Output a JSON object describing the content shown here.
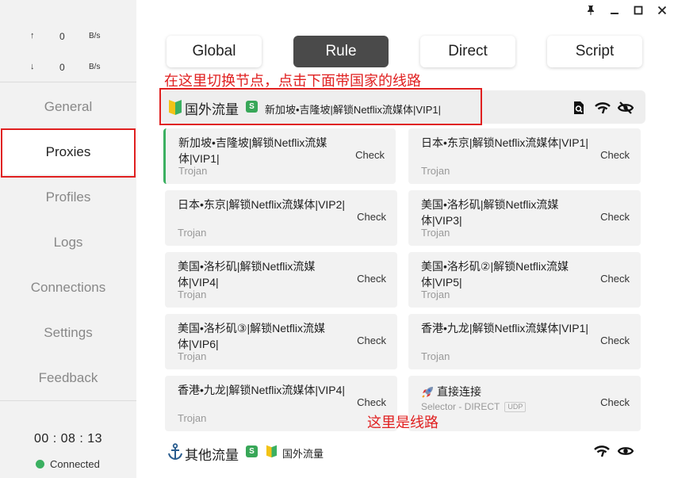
{
  "window": {
    "pin_icon": "pin-icon",
    "minimize_icon": "minimize-icon",
    "maximize_icon": "maximize-icon",
    "close_icon": "close-icon"
  },
  "sidebar": {
    "speed": {
      "upload_arrow": "↑",
      "upload_value": "0",
      "upload_unit": "B/s",
      "download_arrow": "↓",
      "download_value": "0",
      "download_unit": "B/s"
    },
    "nav": [
      {
        "label": "General",
        "active": false
      },
      {
        "label": "Proxies",
        "active": true
      },
      {
        "label": "Profiles",
        "active": false
      },
      {
        "label": "Logs",
        "active": false
      },
      {
        "label": "Connections",
        "active": false
      },
      {
        "label": "Settings",
        "active": false
      },
      {
        "label": "Feedback",
        "active": false
      }
    ],
    "timer": "00 : 08 : 13",
    "status": "Connected",
    "status_color": "#3bb061"
  },
  "modes": [
    {
      "label": "Global",
      "active": false
    },
    {
      "label": "Rule",
      "active": true
    },
    {
      "label": "Direct",
      "active": false
    },
    {
      "label": "Script",
      "active": false
    }
  ],
  "annotations": {
    "top": "在这里切换节点，点击下面带国家的线路",
    "bottom": "这里是线路",
    "color": "#e02020"
  },
  "group": {
    "icon": "beginner-shield-icon",
    "name": "国外流量",
    "badge": "S",
    "selected": "新加坡•吉隆坡|解锁Netflix流媒体|VIP1|",
    "tools": [
      "search-icon",
      "wifi-speed-icon",
      "eye-off-icon"
    ]
  },
  "proxies": [
    {
      "name": "新加坡•吉隆坡|解锁Netflix流媒体|VIP1|",
      "type": "Trojan",
      "action": "Check",
      "selected": true
    },
    {
      "name": "日本•东京|解锁Netflix流媒体|VIP1|",
      "type": "Trojan",
      "action": "Check",
      "selected": false
    },
    {
      "name": "日本•东京|解锁Netflix流媒体|VIP2|",
      "type": "Trojan",
      "action": "Check",
      "selected": false
    },
    {
      "name": "美国•洛杉矶|解锁Netflix流媒体|VIP3|",
      "type": "Trojan",
      "action": "Check",
      "selected": false
    },
    {
      "name": "美国•洛杉矶|解锁Netflix流媒体|VIP4|",
      "type": "Trojan",
      "action": "Check",
      "selected": false
    },
    {
      "name": "美国•洛杉矶②|解锁Netflix流媒体|VIP5|",
      "type": "Trojan",
      "action": "Check",
      "selected": false
    },
    {
      "name": "美国•洛杉矶③|解锁Netflix流媒体|VIP6|",
      "type": "Trojan",
      "action": "Check",
      "selected": false
    },
    {
      "name": "香港•九龙|解锁Netflix流媒体|VIP1|",
      "type": "Trojan",
      "action": "Check",
      "selected": false
    },
    {
      "name": "香港•九龙|解锁Netflix流媒体|VIP4|",
      "type": "Trojan",
      "action": "Check",
      "selected": false
    }
  ],
  "direct_card": {
    "icon": "rocket-icon",
    "name": "直接连接",
    "type": "Selector - DIRECT",
    "udp": "UDP",
    "action": "Check"
  },
  "group2": {
    "icon": "anchor-icon",
    "name": "其他流量",
    "badge": "S",
    "selected_icon": "beginner-shield-icon",
    "selected": "国外流量",
    "tools": [
      "wifi-speed-icon",
      "eye-icon"
    ]
  }
}
